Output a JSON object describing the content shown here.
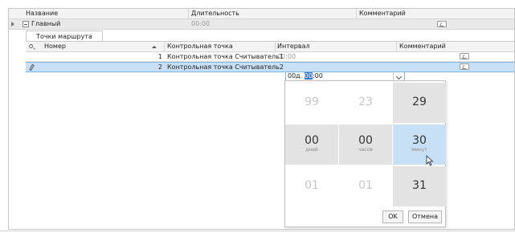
{
  "main_grid": {
    "columns": [
      "Название",
      "Длительность",
      "Комментарий"
    ],
    "row": {
      "name": "Главный",
      "duration": "00:00"
    }
  },
  "detail": {
    "tab": "Точки маршрута",
    "columns": [
      "Номер",
      "Контрольная точка",
      "Интервал",
      "Комментарий"
    ],
    "rows": [
      {
        "number": "1",
        "checkpoint": "Контрольная точка Считыватель1",
        "interval": "00:00"
      },
      {
        "number": "2",
        "checkpoint": "Контрольная точка Считыватель2",
        "interval": ""
      }
    ]
  },
  "editor": {
    "before": "00д. ",
    "selected": "00",
    "after": ":00"
  },
  "picker": {
    "days": {
      "prev": "99",
      "current": "00",
      "next": "01",
      "label": "дней"
    },
    "hours": {
      "prev": "23",
      "current": "00",
      "next": "01",
      "label": "часов"
    },
    "minutes": {
      "prev": "29",
      "current": "30",
      "next": "31",
      "label": "минут"
    },
    "ok_label": "OK",
    "cancel_label": "Отмена"
  },
  "colors": {
    "selection": "#c8e0f5",
    "accent": "#3a7bd5",
    "header": "#f3f3f3"
  },
  "icons": [
    "expand-arrow-icon",
    "collapse-minus-icon",
    "comment-icon",
    "search-icon",
    "sort-asc-icon",
    "pencil-icon",
    "chevron-down-icon",
    "mouse-cursor-icon"
  ]
}
